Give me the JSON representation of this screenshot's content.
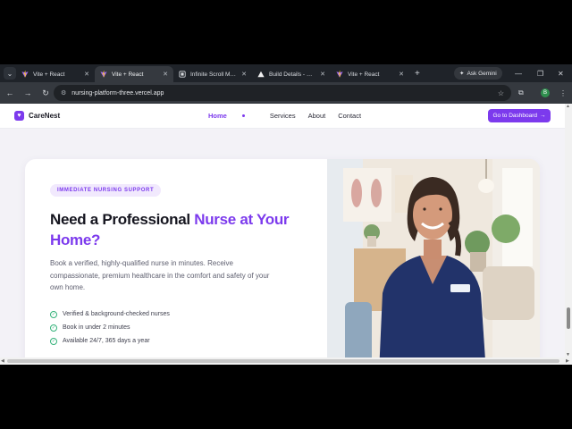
{
  "browser": {
    "tabs": [
      {
        "title": "Vite + React",
        "favicon": "vite-icon",
        "active": false
      },
      {
        "title": "Vite + React",
        "favicon": "vite-icon",
        "active": true
      },
      {
        "title": "Infinite Scroll Meth",
        "favicon": "doc-icon",
        "active": false
      },
      {
        "title": "Build Details - @bl",
        "favicon": "vercel-icon",
        "active": false
      },
      {
        "title": "Vite + React",
        "favicon": "vite-icon",
        "active": false
      }
    ],
    "new_tab": "+",
    "gemini_label": "Ask Gemini",
    "url": "nursing-platform-three.vercel.app",
    "profile_initial": "B"
  },
  "navbar": {
    "brand": "CareNest",
    "links": [
      "Home",
      "Services",
      "About",
      "Contact"
    ],
    "active_link": "Home",
    "cta": "Go to Dashboard",
    "cta_arrow": "→"
  },
  "hero": {
    "badge": "IMMEDIATE NURSING SUPPORT",
    "headline_part1": "Need a Professional ",
    "headline_highlight": "Nurse at Your Home?",
    "description": "Book a verified, highly-qualified nurse in minutes. Receive compassionate, premium healthcare in the comfort and safety of your own home.",
    "features": [
      "Verified & background-checked nurses",
      "Book in under 2 minutes",
      "Available 24/7, 365 days a year"
    ],
    "image_alt": "nurse-photo"
  },
  "colors": {
    "accent": "#7c3aed",
    "check": "#34b27a",
    "chrome_dark": "#1f2329"
  }
}
